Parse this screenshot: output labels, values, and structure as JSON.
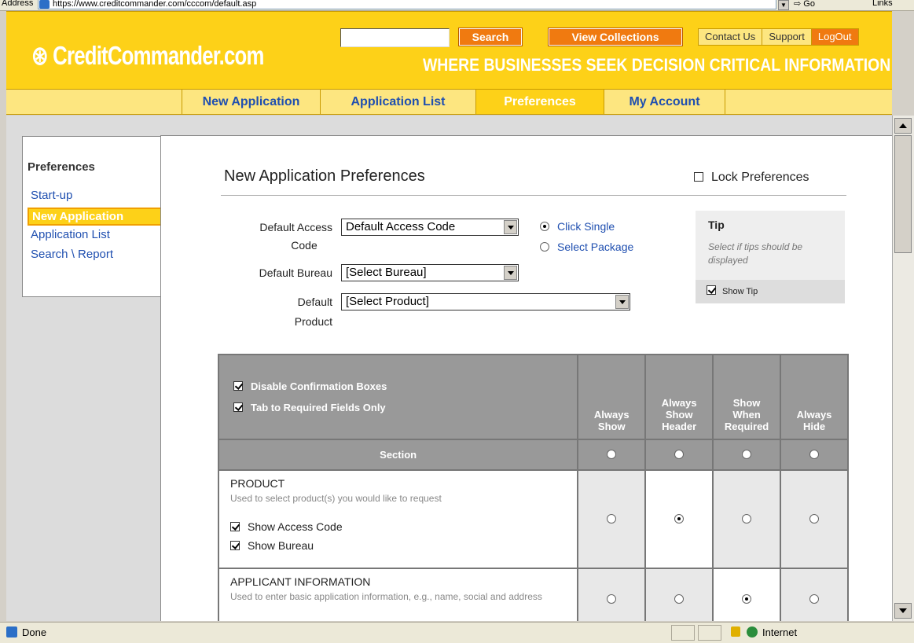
{
  "browser": {
    "address_label": "Address",
    "url": "https://www.creditcommander.com/cccom/default.asp",
    "go_label": "Go",
    "links_label": "Links",
    "status_text": "Done",
    "zone_text": "Internet"
  },
  "header": {
    "logo": "CreditCommander.com",
    "search_button": "Search",
    "collections_button": "View Collections",
    "top_links": [
      "Contact Us",
      "Support",
      "LogOut"
    ],
    "tagline": "WHERE BUSINESSES SEEK DECISION CRITICAL INFORMATION",
    "brand_color": "#fdd118",
    "accent_color": "#f07a10"
  },
  "main_nav": {
    "tabs": [
      {
        "label": "New Application",
        "active": false
      },
      {
        "label": "Application List",
        "active": false
      },
      {
        "label": "Preferences",
        "active": true
      },
      {
        "label": "My Account",
        "active": false
      }
    ]
  },
  "sidebar": {
    "heading": "Preferences",
    "items": [
      {
        "label": "Start-up",
        "active": false
      },
      {
        "label": "New Application",
        "active": true
      },
      {
        "label": "Application List",
        "active": false
      },
      {
        "label": "Search \\ Report",
        "active": false
      }
    ]
  },
  "panel": {
    "title": "New Application Preferences",
    "lock_label": "Lock Preferences",
    "lock_checked": false,
    "fields": {
      "access_code_label_1": "Default Access",
      "access_code_label_2": "Code",
      "access_code_value": "Default Access Code",
      "bureau_label": "Default Bureau",
      "bureau_value": "[Select Bureau]",
      "product_label_1": "Default",
      "product_label_2": "Product",
      "product_value": "[Select Product]"
    },
    "access_mode": {
      "options": [
        "Click Single",
        "Select Package"
      ],
      "selected": "Click Single"
    },
    "tip": {
      "title": "Tip",
      "text": "Select if tips should be displayed",
      "show_tip_label": "Show Tip",
      "show_tip_checked": true
    }
  },
  "grid": {
    "options": [
      {
        "label": "Disable Confirmation Boxes",
        "checked": true
      },
      {
        "label": "Tab to Required Fields Only",
        "checked": true
      }
    ],
    "columns": [
      [
        "Always",
        "Show"
      ],
      [
        "Always",
        "Show",
        "Header"
      ],
      [
        "Show",
        "When",
        "Required"
      ],
      [
        "Always",
        "Hide"
      ]
    ],
    "section_header": "Section",
    "rows": [
      {
        "name": "PRODUCT",
        "description": "Used to select product(s) you would like to request",
        "suboptions": [
          {
            "label": "Show Access Code",
            "checked": true
          },
          {
            "label": "Show Bureau",
            "checked": true
          }
        ],
        "selected_column": 1
      },
      {
        "name": "APPLICANT INFORMATION",
        "description": "Used to enter basic application information, e.g., name, social and address",
        "suboptions": [],
        "selected_column": 2
      }
    ]
  }
}
